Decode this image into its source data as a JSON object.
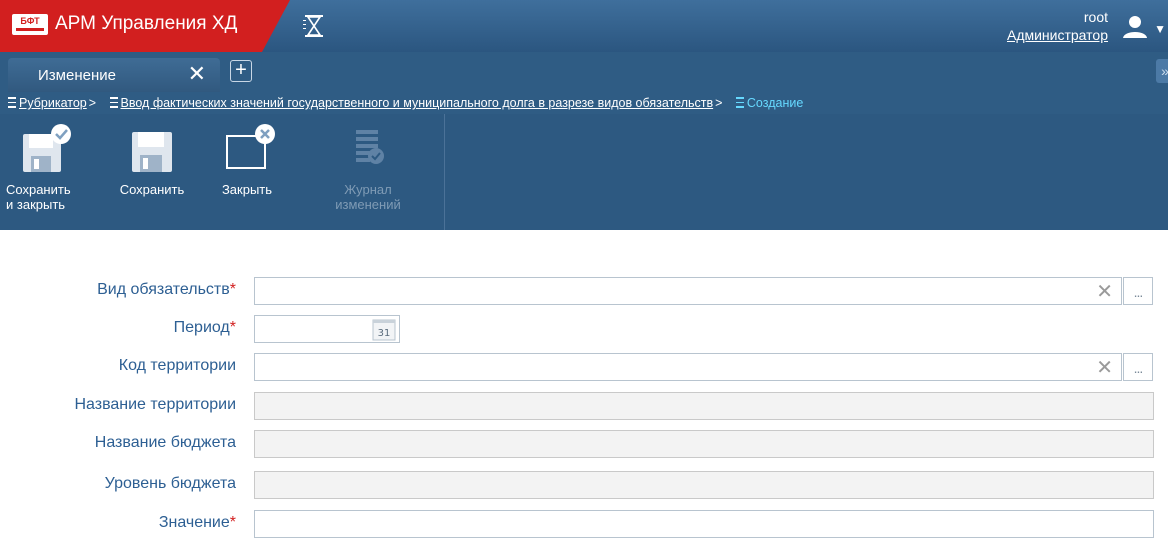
{
  "app": {
    "logo_text": "БФТ",
    "title": "АРМ Управления ХД"
  },
  "user": {
    "name": "root",
    "role": "Администратор"
  },
  "tabs": {
    "active_label": "Изменение",
    "close_glyph": "✕",
    "add_glyph": "+",
    "more_glyph": "»"
  },
  "breadcrumb": {
    "items": [
      "Рубрикатор",
      "Ввод фактических значений государственного и муниципального долга в разрезе видов обязательств"
    ],
    "separator": ">",
    "current": "Создание"
  },
  "toolbar": {
    "save_close_line1": "Сохранить",
    "save_close_line2": "и закрыть",
    "save": "Сохранить",
    "close": "Закрыть",
    "journal_line1": "Журнал",
    "journal_line2": "изменений"
  },
  "form": {
    "required_mark": "*",
    "fields": [
      {
        "label": "Вид обязательств",
        "required": true,
        "value": ""
      },
      {
        "label": "Период",
        "required": true,
        "value": ""
      },
      {
        "label": "Код территории",
        "required": false,
        "value": ""
      },
      {
        "label": "Название территории",
        "required": false,
        "value": ""
      },
      {
        "label": "Название бюджета",
        "required": false,
        "value": ""
      },
      {
        "label": "Уровень бюджета",
        "required": false,
        "value": ""
      },
      {
        "label": "Значение",
        "required": true,
        "value": ""
      }
    ],
    "clear_glyph": "✕",
    "lookup_glyph": "...",
    "calendar_day": "31"
  },
  "colors": {
    "header_bg": "#2d5981",
    "brand_red": "#d21f1f",
    "label_blue": "#2d5f93",
    "breadcrumb_current": "#66d9ff"
  }
}
